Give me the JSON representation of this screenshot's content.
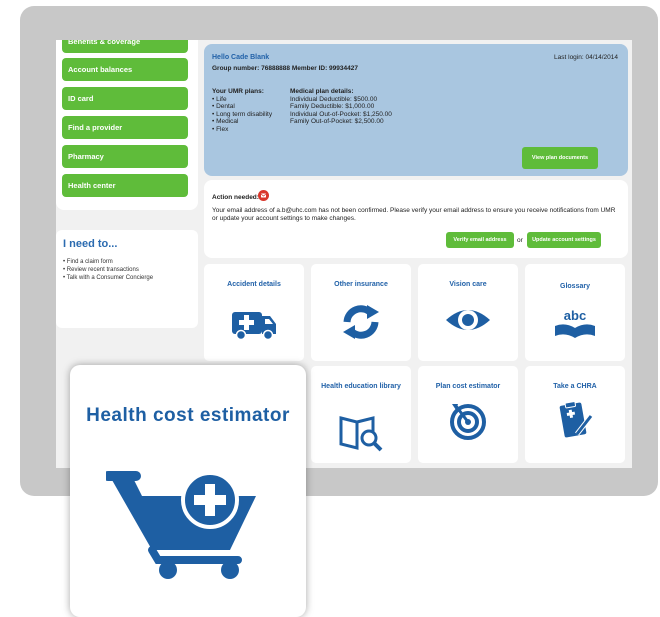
{
  "sidebar": {
    "nav_items": [
      {
        "label": "Benefits & coverage"
      },
      {
        "label": "Account balances"
      },
      {
        "label": "ID card"
      },
      {
        "label": "Find a provider"
      },
      {
        "label": "Pharmacy"
      },
      {
        "label": "Health center"
      }
    ],
    "need": {
      "title": "I need to...",
      "items": [
        "Find a claim form",
        "Review recent transactions",
        "Talk with a Consumer Concierge"
      ]
    }
  },
  "account": {
    "greeting": "Hello Cade Blank",
    "last_login": "Last login: 04/14/2014",
    "group_line": "Group number: 76888888 Member ID: 99934427",
    "plans_title": "Your UMR plans:",
    "plans": [
      "• Life",
      "• Dental",
      "• Long term disability",
      "• Medical",
      "• Flex"
    ],
    "details_title": "Medical plan details:",
    "details": [
      "Individual Deductible: $500.00",
      "Family Deductible: $1,000.00",
      "Individual Out-of-Pocket: $1,250.00",
      "Family Out-of-Pocket: $2,500.00"
    ],
    "view_docs_button": "View plan documents"
  },
  "action": {
    "label": "Action needed:",
    "message": "Your email address of a.b@uhc.com has not been confirmed. Please verify your email address to ensure you receive notifications from UMR or update your account settings to make changes.",
    "verify_button": "Verify email address",
    "or_text": "or",
    "update_button": "Update account settings"
  },
  "tiles": [
    {
      "label": "Accident details",
      "icon": "ambulance-icon"
    },
    {
      "label": "Other insurance",
      "icon": "refresh-arrows-icon"
    },
    {
      "label": "Vision care",
      "icon": "eye-icon"
    },
    {
      "label": "Glossary",
      "icon": "abc-book-icon",
      "icon_text": "abc"
    },
    {
      "label": "Health education library",
      "icon": "book-magnifier-icon"
    },
    {
      "label": "Plan cost estimator",
      "icon": "target-icon"
    },
    {
      "label": "Take a CHRA",
      "icon": "clipboard-icon"
    }
  ],
  "callout": {
    "title": "Health cost estimator",
    "icon": "cart-plus-icon"
  },
  "colors": {
    "green": "#5fbc3a",
    "blue": "#1e5fa3",
    "panel_blue": "#a9c6e0",
    "frame_gray": "#c8c8c8"
  }
}
